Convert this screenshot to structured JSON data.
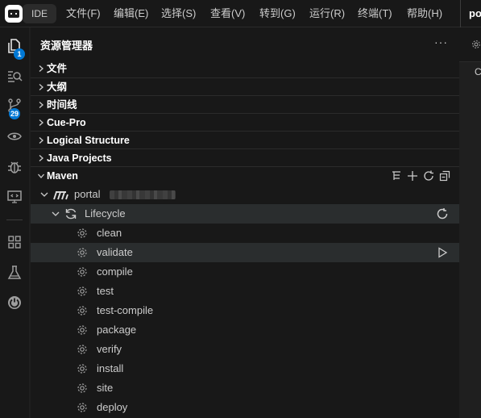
{
  "menubar": {
    "ide_label": "IDE",
    "items": [
      "文件(F)",
      "编辑(E)",
      "选择(S)",
      "查看(V)",
      "转到(G)",
      "运行(R)",
      "终端(T)",
      "帮助(H)"
    ],
    "title": "po"
  },
  "activitybar": {
    "items": [
      {
        "icon": "explorer-icon",
        "badge": "1"
      },
      {
        "icon": "search-icon"
      },
      {
        "icon": "source-control-icon",
        "badge": "29"
      },
      {
        "icon": "eye-icon"
      },
      {
        "icon": "debug-icon"
      },
      {
        "icon": "remote-explorer-icon"
      },
      {
        "icon": "extensions-icon"
      },
      {
        "icon": "testing-icon"
      },
      {
        "icon": "spring-boot-icon"
      }
    ]
  },
  "sidebar": {
    "title": "资源管理器",
    "more": "···",
    "sections": [
      "文件",
      "大纲",
      "时间线",
      "Cue-Pro",
      "Logical Structure",
      "Java Projects",
      "Maven"
    ]
  },
  "maven": {
    "project": "portal",
    "lifecycle": "Lifecycle",
    "phases": [
      "clean",
      "validate",
      "compile",
      "test",
      "test-compile",
      "package",
      "verify",
      "install",
      "site",
      "deploy"
    ],
    "hovered_phase": "validate"
  },
  "editor": {
    "text": "C"
  },
  "colors": {
    "badge": "#0078d4",
    "background": "#1f1f1f",
    "sidebar": "#181818",
    "hover": "#2a2d2e"
  }
}
